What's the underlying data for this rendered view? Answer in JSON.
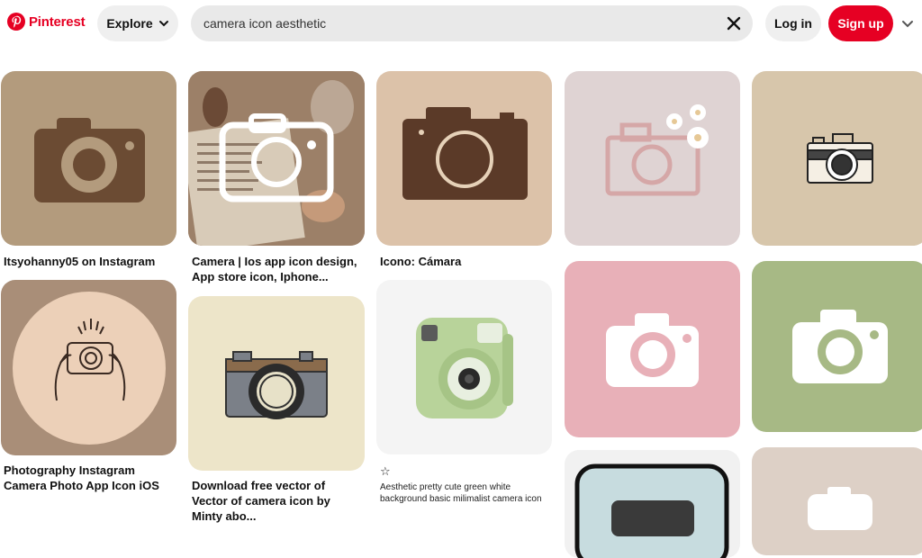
{
  "header": {
    "logo_text": "Pinterest",
    "explore_label": "Explore",
    "search_value": "camera icon aesthetic",
    "login_label": "Log in",
    "signup_label": "Sign up"
  },
  "pins": [
    {
      "caption": "Itsyohanny05 on Instagram"
    },
    {
      "caption": "Photography Instagram Camera Photo App Icon iOS"
    },
    {
      "caption": "Camera | Ios app icon design, App store icon, Iphone..."
    },
    {
      "caption": "Download free vector of Vector of camera icon by Minty abo..."
    },
    {
      "caption": "Icono: Cámara"
    },
    {
      "caption": "☆"
    },
    {
      "description": "Aesthetic pretty cute green white background basic milimalist camera icon"
    }
  ],
  "colors": {
    "brand": "#e60023"
  }
}
